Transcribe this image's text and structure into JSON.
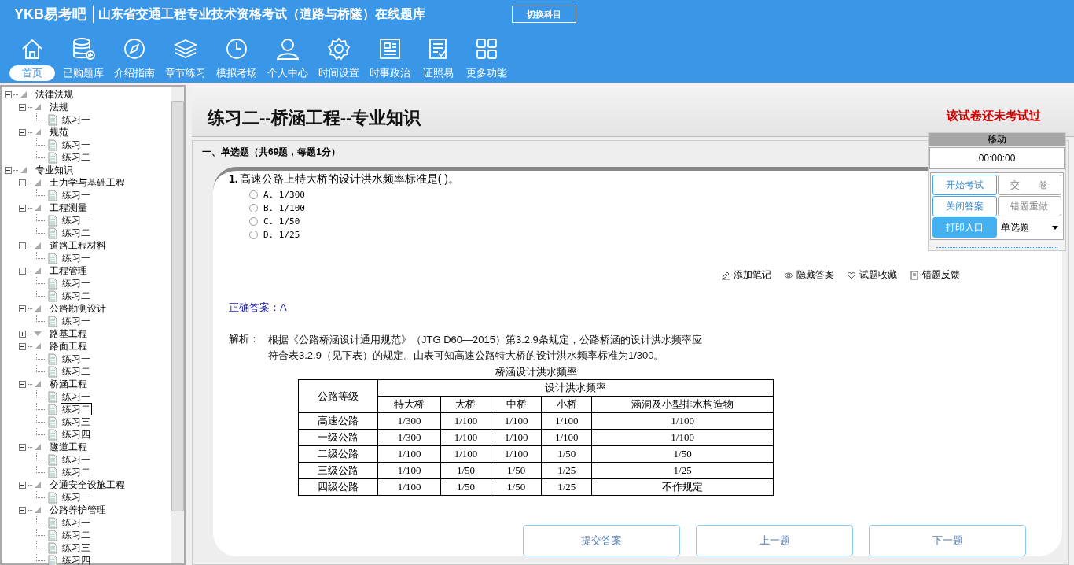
{
  "header": {
    "logo": "YKB易考吧",
    "title": "山东省交通工程专业技术资格考试（道路与桥隧）在线题库",
    "switch_button": "切换科目"
  },
  "nav": [
    {
      "label": "首页",
      "selected": true
    },
    {
      "label": "已购题库",
      "selected": false
    },
    {
      "label": "介绍指南",
      "selected": false
    },
    {
      "label": "章节练习",
      "selected": false
    },
    {
      "label": "模拟考场",
      "selected": false
    },
    {
      "label": "个人中心",
      "selected": false
    },
    {
      "label": "时间设置",
      "selected": false
    },
    {
      "label": "时事政治",
      "selected": false
    },
    {
      "label": "证照易",
      "selected": false
    },
    {
      "label": "更多功能",
      "selected": false
    }
  ],
  "tree": [
    {
      "label": "法律法规",
      "expanded": true,
      "children": [
        {
          "label": "法规",
          "expanded": true,
          "children": [
            {
              "label": "练习一",
              "selected": false
            }
          ]
        },
        {
          "label": "规范",
          "expanded": true,
          "children": [
            {
              "label": "练习一",
              "selected": false
            },
            {
              "label": "练习二",
              "selected": false
            }
          ]
        }
      ]
    },
    {
      "label": "专业知识",
      "expanded": true,
      "children": [
        {
          "label": "土力学与基础工程",
          "expanded": true,
          "children": [
            {
              "label": "练习一",
              "selected": false
            }
          ]
        },
        {
          "label": "工程测量",
          "expanded": true,
          "children": [
            {
              "label": "练习一",
              "selected": false
            },
            {
              "label": "练习二",
              "selected": false
            }
          ]
        },
        {
          "label": "道路工程材料",
          "expanded": true,
          "children": [
            {
              "label": "练习一",
              "selected": false
            }
          ]
        },
        {
          "label": "工程管理",
          "expanded": true,
          "children": [
            {
              "label": "练习一",
              "selected": false
            },
            {
              "label": "练习二",
              "selected": false
            }
          ]
        },
        {
          "label": "公路勘测设计",
          "expanded": true,
          "children": [
            {
              "label": "练习一",
              "selected": false
            }
          ]
        },
        {
          "label": "路基工程",
          "expanded": false
        },
        {
          "label": "路面工程",
          "expanded": true,
          "children": [
            {
              "label": "练习一",
              "selected": false
            },
            {
              "label": "练习二",
              "selected": false
            }
          ]
        },
        {
          "label": "桥涵工程",
          "expanded": true,
          "children": [
            {
              "label": "练习一",
              "selected": false
            },
            {
              "label": "练习二",
              "selected": true
            },
            {
              "label": "练习三",
              "selected": false
            },
            {
              "label": "练习四",
              "selected": false
            }
          ]
        },
        {
          "label": "隧道工程",
          "expanded": true,
          "children": [
            {
              "label": "练习一",
              "selected": false
            },
            {
              "label": "练习二",
              "selected": false
            }
          ]
        },
        {
          "label": "交通安全设施工程",
          "expanded": true,
          "children": [
            {
              "label": "练习一",
              "selected": false
            }
          ]
        },
        {
          "label": "公路养护管理",
          "expanded": true,
          "children": [
            {
              "label": "练习一",
              "selected": false
            },
            {
              "label": "练习二",
              "selected": false
            },
            {
              "label": "练习三",
              "selected": false
            },
            {
              "label": "练习四",
              "selected": false
            }
          ]
        }
      ]
    }
  ],
  "paper": {
    "title": "练习二--桥涵工程--专业知识",
    "status": "该试卷还未考试过"
  },
  "section": "一、单选题（共69题，每题1分）",
  "question": {
    "number": "1.",
    "text": "高速公路上特大桥的设计洪水频率标准是( )。",
    "options": [
      {
        "label": "A. 1/300",
        "checked": false
      },
      {
        "label": "B. 1/100",
        "checked": false
      },
      {
        "label": "C. 1/50",
        "checked": false
      },
      {
        "label": "D. 1/25",
        "checked": false
      }
    ]
  },
  "actions": [
    "添加笔记",
    "隐藏答案",
    "试题收藏",
    "错题反馈"
  ],
  "answer": "正确答案：A",
  "analysis": {
    "label": "解析：",
    "lines": [
      "根据《公路桥涵设计通用规范》（JTG D60—2015）第3.2.9条规定，公路桥涵的设计洪水频率应",
      "符合表3.2.9（见下表）的规定。由表可知高速公路特大桥的设计洪水频率标准为1/300。"
    ]
  },
  "table": {
    "title": "桥涵设计洪水频率",
    "group_header": "设计洪水频率",
    "columns": [
      "公路等级",
      "特大桥",
      "大桥",
      "中桥",
      "小桥",
      "涵洞及小型排水构造物"
    ],
    "rows": [
      [
        "高速公路",
        "1/300",
        "1/100",
        "1/100",
        "1/100",
        "1/100"
      ],
      [
        "一级公路",
        "1/300",
        "1/100",
        "1/100",
        "1/100",
        "1/100"
      ],
      [
        "二级公路",
        "1/100",
        "1/100",
        "1/100",
        "1/50",
        "1/50"
      ],
      [
        "三级公路",
        "1/100",
        "1/50",
        "1/50",
        "1/25",
        "1/25"
      ],
      [
        "四级公路",
        "1/100",
        "1/50",
        "1/50",
        "1/25",
        "不作规定"
      ]
    ]
  },
  "nav_buttons": [
    "提交答案",
    "上一题",
    "下一题"
  ],
  "panel": {
    "header": "移动",
    "timer": "00:00:00",
    "buttons": [
      {
        "label": "开始考试",
        "kind": "outline"
      },
      {
        "label": "交　　卷",
        "kind": "plain"
      },
      {
        "label": "关闭答案",
        "kind": "outline"
      },
      {
        "label": "错题重做",
        "kind": "plain"
      },
      {
        "label": "打印入口",
        "kind": "filled"
      }
    ],
    "select": "单选题"
  }
}
